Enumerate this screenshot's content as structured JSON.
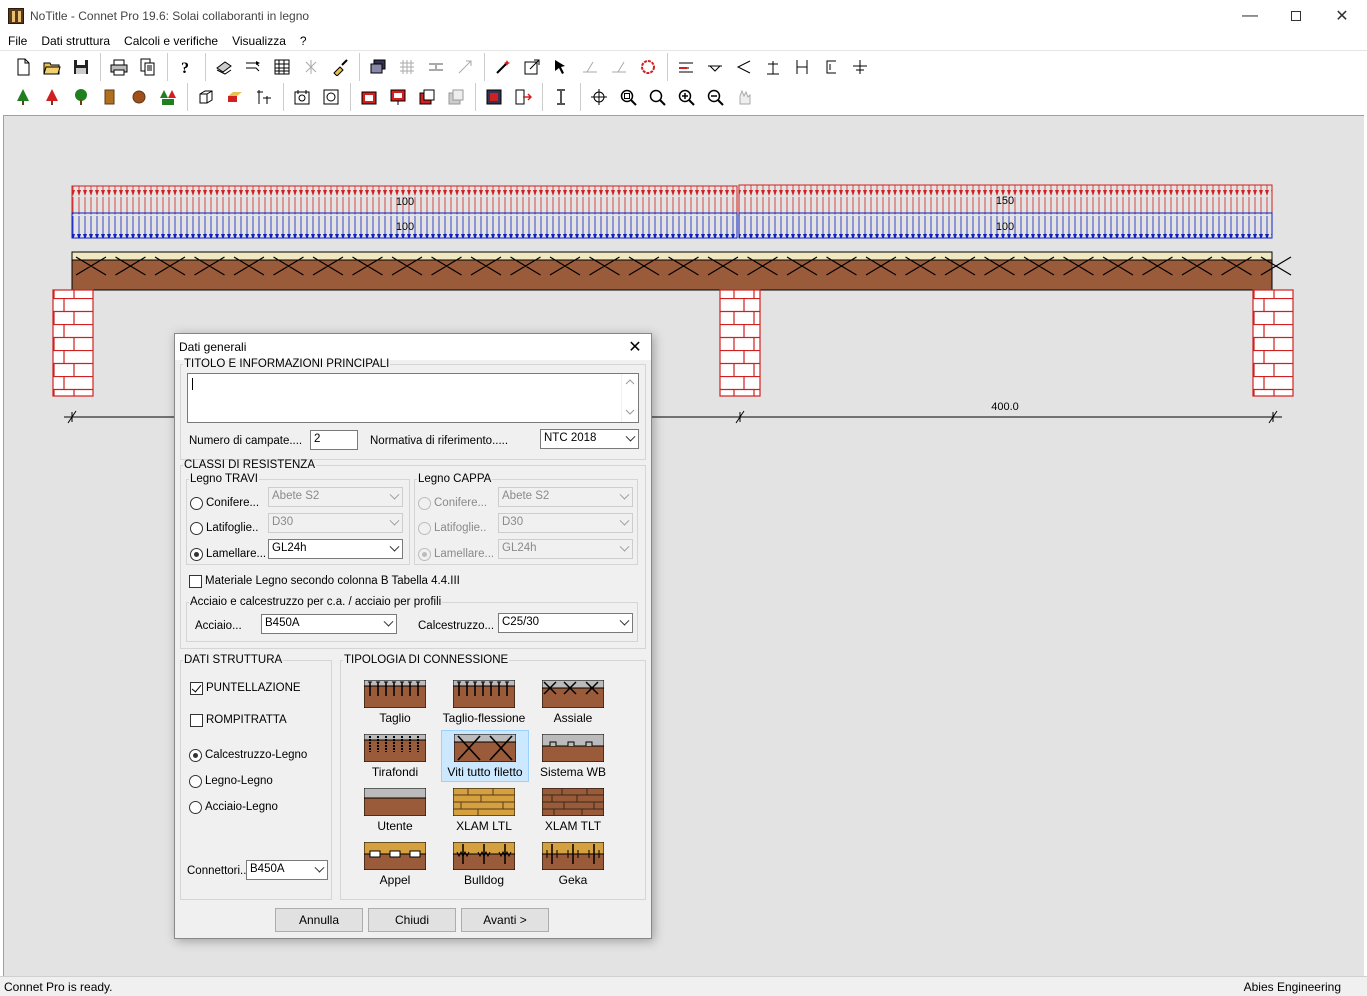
{
  "window": {
    "title": "NoTitle - Connet Pro 19.6: Solai collaboranti in legno"
  },
  "menu": [
    "File",
    "Dati struttura",
    "Calcoli e verifiche",
    "Visualizza",
    "?"
  ],
  "drawing": {
    "loads_span1": {
      "top": "100",
      "bottom": "100"
    },
    "loads_span2": {
      "top": "150",
      "bottom": "100"
    },
    "dimension_span2": "400.0",
    "colors": {
      "load_top": "#d02020",
      "load_bottom": "#1020c0",
      "timber": "#9a5b3a",
      "support": "#d02020"
    }
  },
  "dialog": {
    "title": "Dati generali",
    "title_section": "TITOLO E INFORMAZIONI PRINCIPALI",
    "title_value": "",
    "num_campate_label": "Numero di campate....",
    "num_campate_value": "2",
    "normativa_label": "Normativa di riferimento.....",
    "normativa_value": "NTC 2018",
    "classi_label": "CLASSI DI RESISTENZA",
    "legno_travi": {
      "label": "Legno TRAVI",
      "options": [
        {
          "label": "Conifere...",
          "value": "Abete S2",
          "selected": false
        },
        {
          "label": "Latifoglie..",
          "value": "D30",
          "selected": false
        },
        {
          "label": "Lamellare...",
          "value": "GL24h",
          "selected": true
        }
      ]
    },
    "legno_cappa": {
      "label": "Legno CAPPA",
      "options": [
        {
          "label": "Conifere...",
          "value": "Abete S2",
          "selected": false
        },
        {
          "label": "Latifoglie..",
          "value": "D30",
          "selected": false
        },
        {
          "label": "Lamellare...",
          "value": "GL24h",
          "selected": true
        }
      ]
    },
    "materiale_check": "Materiale Legno secondo colonna B Tabella 4.4.III",
    "acciaio_section": "Acciaio e calcestruzzo per c.a. / acciaio per profili",
    "acciaio_label": "Acciaio...",
    "acciaio_value": "B450A",
    "cls_label": "Calcestruzzo...",
    "cls_value": "C25/30",
    "dati_struttura": {
      "label": "DATI STRUTTURA",
      "puntellazione": "PUNTELLAZIONE",
      "rompitratta": "ROMPITRATTA",
      "types": [
        "Calcestruzzo-Legno",
        "Legno-Legno",
        "Acciaio-Legno"
      ],
      "connettori_label": "Connettori...",
      "connettori_value": "B450A"
    },
    "tipologia": {
      "label": "TIPOLOGIA DI CONNESSIONE",
      "items": [
        "Taglio",
        "Taglio-flessione",
        "Assiale",
        "Tirafondi",
        "Viti tutto filetto",
        "Sistema WB",
        "Utente",
        "XLAM LTL",
        "XLAM TLT",
        "Appel",
        "Bulldog",
        "Geka"
      ],
      "selected": "Viti tutto filetto"
    },
    "buttons": {
      "annulla": "Annulla",
      "chiudi": "Chiudi",
      "avanti": "Avanti >"
    }
  },
  "status": {
    "left": "Connet Pro is ready.",
    "right": "Abies Engineering"
  }
}
